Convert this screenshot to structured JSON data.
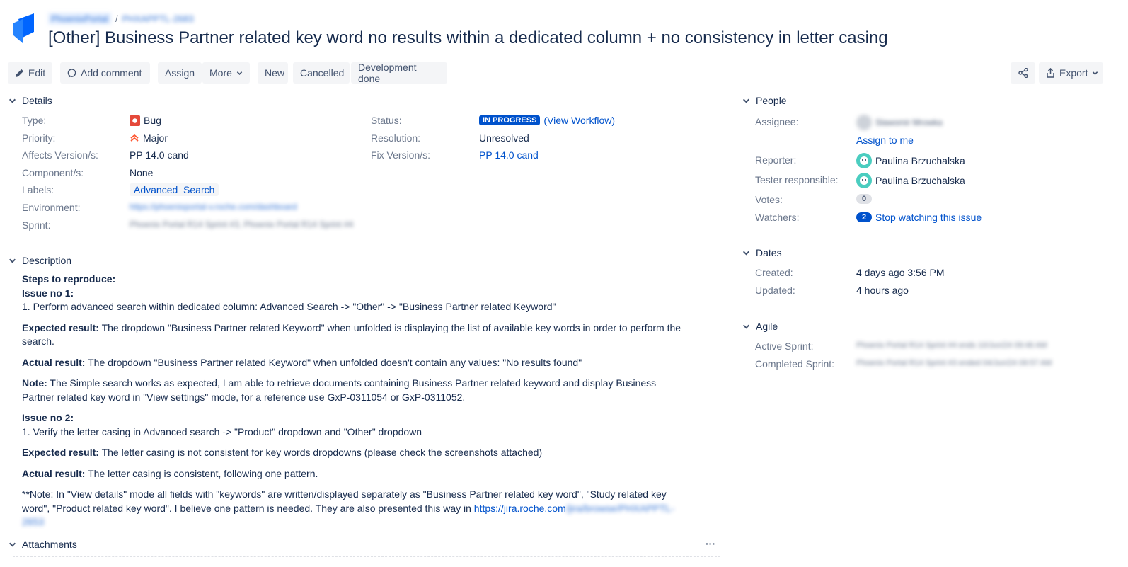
{
  "breadcrumb": {
    "project": "PhoenixPortal",
    "issue_key": "PHXAPPTL-2683"
  },
  "issue_title": "[Other] Business Partner related key word no results within a dedicated column + no consistency in letter casing",
  "toolbar": {
    "edit": "Edit",
    "add_comment": "Add comment",
    "assign": "Assign",
    "more": "More",
    "new": "New",
    "cancelled": "Cancelled",
    "development_done": "Development done",
    "share_icon": "share-icon",
    "export": "Export"
  },
  "details": {
    "heading": "Details",
    "type_label": "Type:",
    "type_value": "Bug",
    "priority_label": "Priority:",
    "priority_value": "Major",
    "affects_label": "Affects Version/s:",
    "affects_value": "PP 14.0 cand",
    "component_label": "Component/s:",
    "component_value": "None",
    "labels_label": "Labels:",
    "labels_value": "Advanced_Search",
    "environment_label": "Environment:",
    "environment_value": "https://phoenixportal-v.roche.com/dashboard",
    "sprint_label": "Sprint:",
    "sprint_value": "Phoenix Portal R14 Sprint #3, Phoenix Portal R14 Sprint #4",
    "status_label": "Status:",
    "status_value": "IN PROGRESS",
    "view_workflow": "(View Workflow)",
    "resolution_label": "Resolution:",
    "resolution_value": "Unresolved",
    "fix_label": "Fix Version/s:",
    "fix_value": "PP 14.0 cand",
    "status_color": "#0052cc"
  },
  "people": {
    "heading": "People",
    "assignee_label": "Assignee:",
    "assignee_value": "Slawomir Mrowka",
    "assign_to_me": "Assign to me",
    "reporter_label": "Reporter:",
    "reporter_value": "Paulina Brzuchalska",
    "tester_label": "Tester responsible:",
    "tester_value": "Paulina Brzuchalska",
    "votes_label": "Votes:",
    "votes_value": "0",
    "watchers_label": "Watchers:",
    "watchers_value": "2",
    "stop_watching": "Stop watching this issue"
  },
  "dates": {
    "heading": "Dates",
    "created_label": "Created:",
    "created_value": "4 days ago 3:56 PM",
    "updated_label": "Updated:",
    "updated_value": "4 hours ago"
  },
  "agile": {
    "heading": "Agile",
    "active_label": "Active Sprint:",
    "active_value": "Phoenix Portal R14 Sprint #4 ends 10/Jun/24 09:46 AM",
    "completed_label": "Completed Sprint:",
    "completed_value": "Phoenix Portal R14 Sprint #3 ended 04/Jun/24 09:57 AM"
  },
  "description": {
    "heading": "Description",
    "steps": "Steps to reproduce:",
    "issue1": "Issue no 1:",
    "issue1_step": "1. Perform advanced search within dedicated column: Advanced Search -> \"Other\" -> \"Business Partner related Keyword\"",
    "expected_label": "Expected result:",
    "expected1": " The dropdown \"Business Partner related Keyword\" when unfolded is displaying the list of available key words in order to perform the search.",
    "actual_label": "Actual result:",
    "actual1": " The dropdown \"Business Partner related Keyword\" when unfolded doesn't contain any values: \"No results found\"",
    "note_label": "Note:",
    "note": " The Simple search works as expected, I am able to retrieve documents containing Business Partner related keyword and display Business Partner related key word in \"View settings\" mode, for a reference use GxP-0311054 or GxP-0311052.",
    "issue2": "Issue no 2:",
    "issue2_step": "1. Verify the letter casing in Advanced search -> \"Product\" dropdown and \"Other\" dropdown",
    "expected2": " The letter casing is not consistent for key words dropdowns (please check the screenshots attached)",
    "actual2": " The letter casing is consistent, following one pattern.",
    "note2": "**Note: In \"View details\" mode all fields with \"keywords\" are written/displayed separately as \"Business Partner related key word\",  \"Study related key word\", \"Product related key word\". I believe one pattern is needed. They are also presented this way in ",
    "note2_link": "https://jira.roche.com",
    "note2_link_blur": "/jira/browse/PHXAPPTL-2653"
  },
  "attachments": {
    "heading": "Attachments",
    "more": "···"
  }
}
